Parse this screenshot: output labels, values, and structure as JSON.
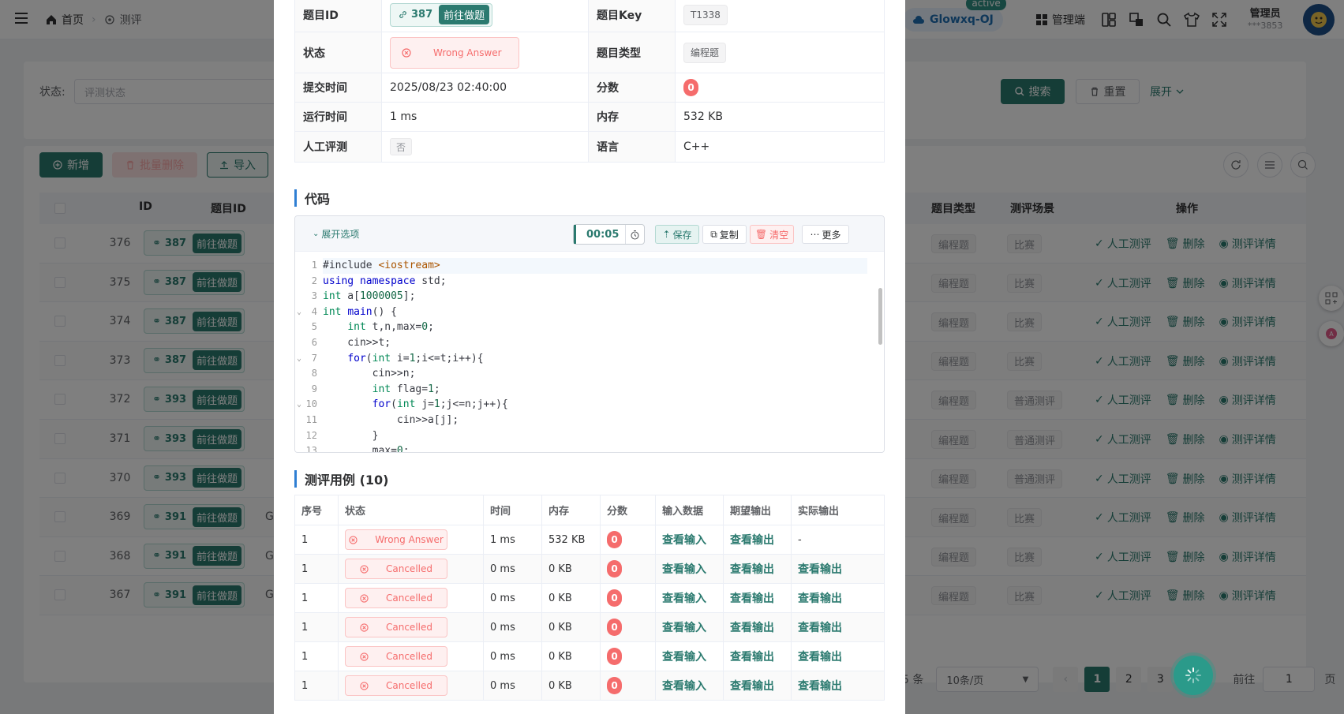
{
  "colors": {
    "primary": "#2b7a6f",
    "danger": "#f56c6c",
    "site_pill": "#1f6fb2"
  },
  "topbar": {
    "home": "首页",
    "current": "测评",
    "site": "Glowxq-OJ",
    "site_badge": "active",
    "admin": "管理端",
    "user_name": "管理员",
    "user_sub": "***3853"
  },
  "search": {
    "label": "状态:",
    "placeholder": "评测状态",
    "search_btn": "搜索",
    "reset_btn": "重置",
    "expand": "展开"
  },
  "toolbar": {
    "add": "新增",
    "batch_delete": "批量删除",
    "import": "导入"
  },
  "table": {
    "headers": {
      "id": "ID",
      "problem_id": "题目ID",
      "type": "题目类型",
      "scene": "测评场景",
      "ops": "操作"
    },
    "go_label": "前往做题",
    "ops": {
      "manual": "人工测评",
      "delete": "删除",
      "detail": "测评详情"
    },
    "rows": [
      {
        "id": "376",
        "pid": "387",
        "g": "",
        "type": "编程题",
        "scene": "比赛"
      },
      {
        "id": "375",
        "pid": "387",
        "g": "",
        "type": "编程题",
        "scene": "比赛"
      },
      {
        "id": "374",
        "pid": "387",
        "g": "",
        "type": "编程题",
        "scene": "比赛"
      },
      {
        "id": "373",
        "pid": "387",
        "g": "",
        "type": "编程题",
        "scene": "比赛"
      },
      {
        "id": "372",
        "pid": "393",
        "g": "",
        "type": "编程题",
        "scene": "普通测评"
      },
      {
        "id": "371",
        "pid": "393",
        "g": "",
        "type": "编程题",
        "scene": "普通测评"
      },
      {
        "id": "370",
        "pid": "393",
        "g": "",
        "type": "编程题",
        "scene": "普通测评"
      },
      {
        "id": "369",
        "pid": "391",
        "g": "G",
        "type": "编程题",
        "scene": "比赛"
      },
      {
        "id": "368",
        "pid": "391",
        "g": "G",
        "type": "编程题",
        "scene": "比赛"
      },
      {
        "id": "367",
        "pid": "391",
        "g": "G",
        "type": "编程题",
        "scene": "比赛"
      }
    ]
  },
  "pagination": {
    "total_suffix": "5 条",
    "page_size": "10条/页",
    "pages": [
      "1",
      "2",
      "3"
    ],
    "goto_label": "前往",
    "goto_value": "1",
    "page_unit": "页"
  },
  "detail": {
    "labels": {
      "problem_id": "题目ID",
      "problem_key": "题目Key",
      "status": "状态",
      "problem_type": "题目类型",
      "submit_time": "提交时间",
      "score": "分数",
      "run_time": "运行时间",
      "memory": "内存",
      "manual": "人工评测",
      "language": "语言"
    },
    "problem_id": "387",
    "go_label": "前往做题",
    "problem_key": "T1338",
    "status": "Wrong Answer",
    "problem_type": "编程题",
    "submit_time": "2025/08/23 02:40:00",
    "score": "0",
    "run_time": "1 ms",
    "memory": "532 KB",
    "manual": "否",
    "language": "C++"
  },
  "code_section": {
    "title": "代码",
    "toggle": "展开选项",
    "timer": "00:05",
    "save": "保存",
    "copy": "复制",
    "clear": "清空",
    "more": "更多"
  },
  "code_lines": [
    "1",
    "2",
    "3",
    "4",
    "5",
    "6",
    "7",
    "8",
    "9",
    "10",
    "11",
    "12",
    "13"
  ],
  "cases_section": {
    "title": "测评用例 (10)",
    "headers": [
      "序号",
      "状态",
      "时间",
      "内存",
      "分数",
      "输入数据",
      "期望输出",
      "实际输出"
    ],
    "view_input": "查看输入",
    "view_expected": "查看输出",
    "view_actual": "查看输出",
    "rows": [
      {
        "idx": "1",
        "status": "Wrong Answer",
        "time": "1 ms",
        "mem": "532 KB",
        "score": "0",
        "actual": "-"
      },
      {
        "idx": "1",
        "status": "Cancelled",
        "time": "0 ms",
        "mem": "0 KB",
        "score": "0",
        "actual": "查看输出"
      },
      {
        "idx": "1",
        "status": "Cancelled",
        "time": "0 ms",
        "mem": "0 KB",
        "score": "0",
        "actual": "查看输出"
      },
      {
        "idx": "1",
        "status": "Cancelled",
        "time": "0 ms",
        "mem": "0 KB",
        "score": "0",
        "actual": "查看输出"
      },
      {
        "idx": "1",
        "status": "Cancelled",
        "time": "0 ms",
        "mem": "0 KB",
        "score": "0",
        "actual": "查看输出"
      },
      {
        "idx": "1",
        "status": "Cancelled",
        "time": "0 ms",
        "mem": "0 KB",
        "score": "0",
        "actual": "查看输出"
      }
    ]
  },
  "icons": {
    "menu": "menu-icon",
    "home": "home-icon",
    "search": "search-icon",
    "close": "close-circle-icon",
    "link": "link-icon",
    "timer": "stopwatch-icon",
    "fab": "loading-spinner-icon"
  }
}
